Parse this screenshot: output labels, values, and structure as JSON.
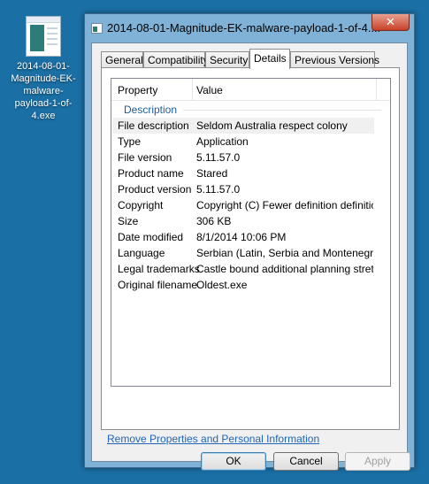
{
  "desktop": {
    "icon_label": "2014-08-01-Magnitude-EK-malware-payload-1-of-4.exe"
  },
  "window": {
    "title": "2014-08-01-Magnitude-EK-malware-payload-1-of-4....",
    "close_glyph": "✕"
  },
  "tabs": [
    "General",
    "Compatibility",
    "Security",
    "Details",
    "Previous Versions"
  ],
  "details": {
    "col_property": "Property",
    "col_value": "Value",
    "group": "Description",
    "rows": [
      {
        "key": "File description",
        "value": "Seldom Australia respect colony"
      },
      {
        "key": "Type",
        "value": "Application"
      },
      {
        "key": "File version",
        "value": "5.11.57.0"
      },
      {
        "key": "Product name",
        "value": "Stared"
      },
      {
        "key": "Product version",
        "value": "5.11.57.0"
      },
      {
        "key": "Copyright",
        "value": "Copyright (C) Fewer definition definition ..."
      },
      {
        "key": "Size",
        "value": "306 KB"
      },
      {
        "key": "Date modified",
        "value": "8/1/2014 10:06 PM"
      },
      {
        "key": "Language",
        "value": "Serbian (Latin, Serbia and Montenegro ..."
      },
      {
        "key": "Legal trademarks",
        "value": "Castle bound additional planning stretc..."
      },
      {
        "key": "Original filename",
        "value": "Oldest.exe"
      }
    ]
  },
  "link_text": "Remove Properties and Personal Information",
  "buttons": {
    "ok": "OK",
    "cancel": "Cancel",
    "apply": "Apply"
  }
}
